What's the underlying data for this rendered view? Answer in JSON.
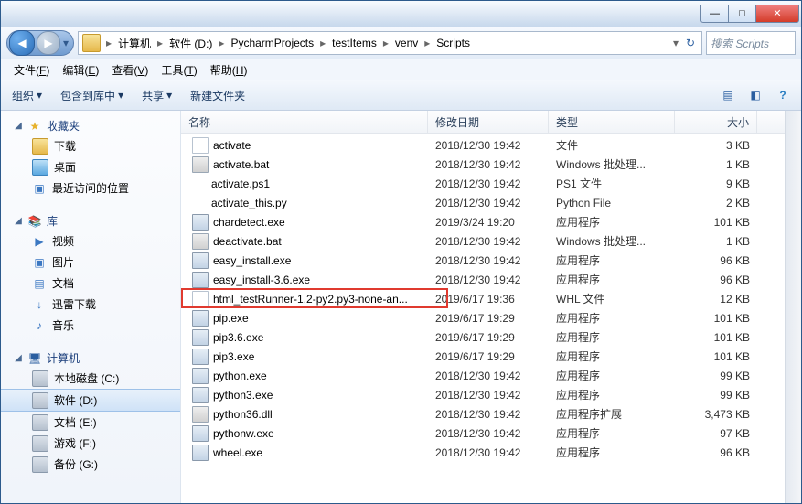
{
  "title_bar": {
    "min": "—",
    "max": "□",
    "close": "✕"
  },
  "address": {
    "back": "◀",
    "fwd": "▶",
    "drop": "▾",
    "segs": [
      "计算机",
      "软件 (D:)",
      "PycharmProjects",
      "testItems",
      "venv",
      "Scripts"
    ],
    "sep": "▸",
    "sep_down": "▾",
    "refresh": "↻"
  },
  "search": {
    "placeholder": "搜索 Scripts"
  },
  "menu": {
    "items": [
      {
        "l": "文件",
        "k": "F"
      },
      {
        "l": "编辑",
        "k": "E"
      },
      {
        "l": "查看",
        "k": "V"
      },
      {
        "l": "工具",
        "k": "T"
      },
      {
        "l": "帮助",
        "k": "H"
      }
    ]
  },
  "toolbar": {
    "organize": "组织",
    "include": "包含到库中",
    "share": "共享",
    "newfolder": "新建文件夹",
    "drop": "▾",
    "view": "▤",
    "preview": "◧",
    "help": "?"
  },
  "nav": {
    "fav": {
      "head": "收藏夹",
      "items": [
        "下载",
        "桌面",
        "最近访问的位置"
      ]
    },
    "lib": {
      "head": "库",
      "items": [
        "视频",
        "图片",
        "文档",
        "迅雷下载",
        "音乐"
      ]
    },
    "pc": {
      "head": "计算机",
      "items": [
        "本地磁盘 (C:)",
        "软件 (D:)",
        "文档 (E:)",
        "游戏 (F:)",
        "备份 (G:)"
      ],
      "selected": 1
    }
  },
  "columns": {
    "name": "名称",
    "date": "修改日期",
    "type": "类型",
    "size": "大小"
  },
  "files": [
    {
      "icon": "blank",
      "name": "activate",
      "date": "2018/12/30 19:42",
      "type": "文件",
      "size": "3 KB"
    },
    {
      "icon": "bat",
      "name": "activate.bat",
      "date": "2018/12/30 19:42",
      "type": "Windows 批处理...",
      "size": "1 KB"
    },
    {
      "icon": "ps1",
      "name": "activate.ps1",
      "date": "2018/12/30 19:42",
      "type": "PS1 文件",
      "size": "9 KB"
    },
    {
      "icon": "py",
      "name": "activate_this.py",
      "date": "2018/12/30 19:42",
      "type": "Python File",
      "size": "2 KB"
    },
    {
      "icon": "exe",
      "name": "chardetect.exe",
      "date": "2019/3/24 19:20",
      "type": "应用程序",
      "size": "101 KB"
    },
    {
      "icon": "bat",
      "name": "deactivate.bat",
      "date": "2018/12/30 19:42",
      "type": "Windows 批处理...",
      "size": "1 KB"
    },
    {
      "icon": "exe",
      "name": "easy_install.exe",
      "date": "2018/12/30 19:42",
      "type": "应用程序",
      "size": "96 KB"
    },
    {
      "icon": "exe",
      "name": "easy_install-3.6.exe",
      "date": "2018/12/30 19:42",
      "type": "应用程序",
      "size": "96 KB"
    },
    {
      "icon": "blank",
      "name": "html_testRunner-1.2-py2.py3-none-an...",
      "date": "2019/6/17 19:36",
      "type": "WHL 文件",
      "size": "12 KB",
      "highlight": true
    },
    {
      "icon": "exe",
      "name": "pip.exe",
      "date": "2019/6/17 19:29",
      "type": "应用程序",
      "size": "101 KB"
    },
    {
      "icon": "exe",
      "name": "pip3.6.exe",
      "date": "2019/6/17 19:29",
      "type": "应用程序",
      "size": "101 KB"
    },
    {
      "icon": "exe",
      "name": "pip3.exe",
      "date": "2019/6/17 19:29",
      "type": "应用程序",
      "size": "101 KB"
    },
    {
      "icon": "exe",
      "name": "python.exe",
      "date": "2018/12/30 19:42",
      "type": "应用程序",
      "size": "99 KB"
    },
    {
      "icon": "exe",
      "name": "python3.exe",
      "date": "2018/12/30 19:42",
      "type": "应用程序",
      "size": "99 KB"
    },
    {
      "icon": "dll",
      "name": "python36.dll",
      "date": "2018/12/30 19:42",
      "type": "应用程序扩展",
      "size": "3,473 KB"
    },
    {
      "icon": "exe",
      "name": "pythonw.exe",
      "date": "2018/12/30 19:42",
      "type": "应用程序",
      "size": "97 KB"
    },
    {
      "icon": "exe",
      "name": "wheel.exe",
      "date": "2018/12/30 19:42",
      "type": "应用程序",
      "size": "96 KB"
    }
  ]
}
